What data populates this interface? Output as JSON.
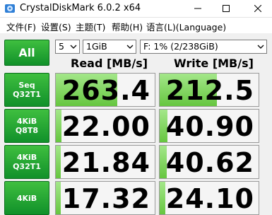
{
  "window": {
    "title": "CrystalDiskMark 6.0.2 x64",
    "controls": [
      "minimize-icon",
      "maximize-icon",
      "close-icon"
    ]
  },
  "menu": {
    "items": [
      "文件(F)",
      "设置(S)",
      "主题(T)",
      "帮助(H)",
      "语言(L)(Language)"
    ]
  },
  "controls": {
    "all_label": "All",
    "count": "5",
    "size": "1GiB",
    "drive": "F: 1% (2/238GiB)"
  },
  "headers": {
    "read": "Read [MB/s]",
    "write": "Write [MB/s]"
  },
  "rows": [
    {
      "line1": "Seq",
      "line2": "Q32T1",
      "read": "263.4",
      "write": "212.5",
      "read_fill": 0.62,
      "write_fill": 0.58
    },
    {
      "line1": "4KiB",
      "line2": "Q8T8",
      "read": "22.00",
      "write": "40.90",
      "read_fill": 0.06,
      "write_fill": 0.08
    },
    {
      "line1": "4KiB",
      "line2": "Q32T1",
      "read": "21.84",
      "write": "40.62",
      "read_fill": 0.05,
      "write_fill": 0.07
    },
    {
      "line1": "4KiB",
      "line2": "",
      "read": "17.32",
      "write": "24.10",
      "read_fill": 0.05,
      "write_fill": 0.06
    }
  ],
  "colors": {
    "accent_green": "#1fa83a",
    "bar_green": "#7cd35a"
  }
}
